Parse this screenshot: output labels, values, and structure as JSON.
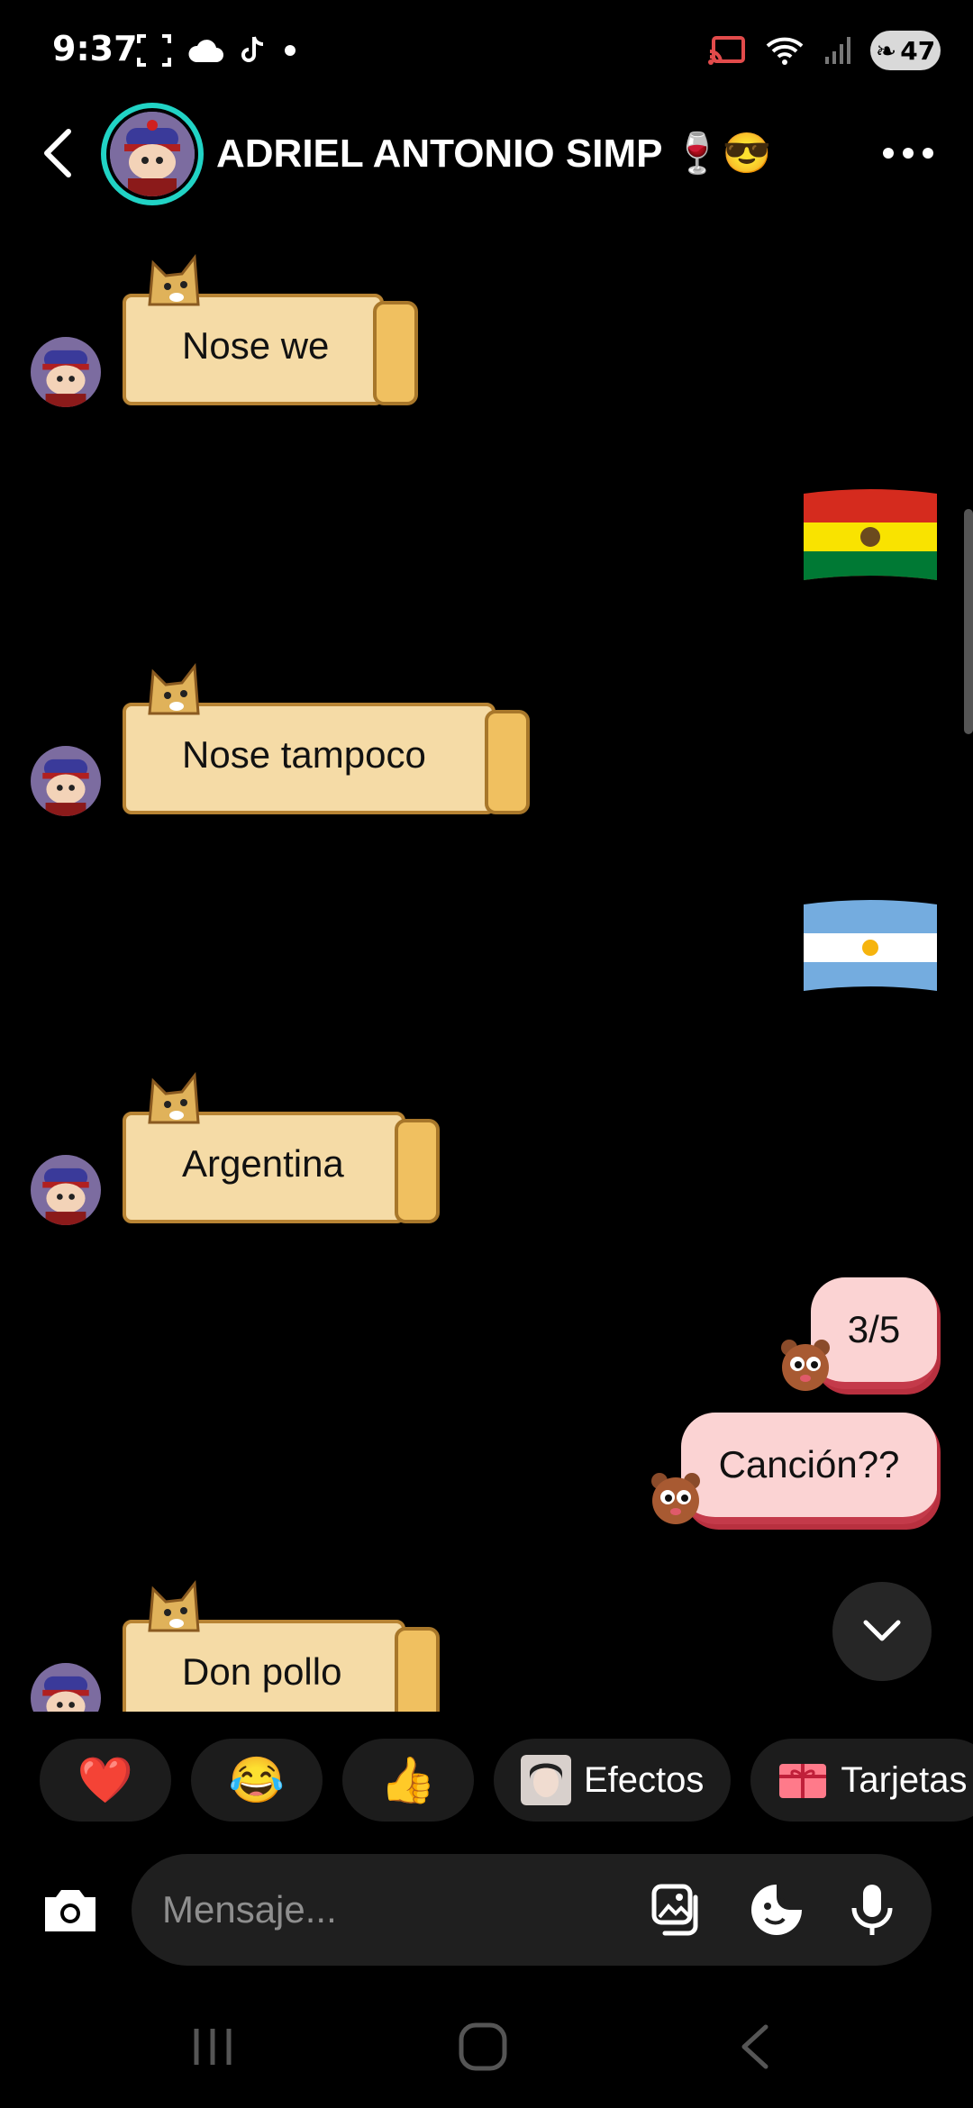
{
  "status_bar": {
    "time": "9:37",
    "battery": "47"
  },
  "header": {
    "title": "ADRIEL ANTONIO SIMP 🍷😎"
  },
  "messages": [
    {
      "side": "left",
      "type": "sticker-text",
      "text": "Nose we"
    },
    {
      "side": "right",
      "type": "flag",
      "label": "Bolivia flag"
    },
    {
      "side": "left",
      "type": "sticker-text",
      "text": "Nose tampoco"
    },
    {
      "side": "right",
      "type": "flag",
      "label": "Argentina flag"
    },
    {
      "side": "left",
      "type": "sticker-text",
      "text": "Argentina"
    },
    {
      "side": "right",
      "type": "text",
      "text": "3/5"
    },
    {
      "side": "right",
      "type": "text",
      "text": "Canción??"
    },
    {
      "side": "left",
      "type": "sticker-text",
      "text": "Don pollo"
    }
  ],
  "quick_reactions": [
    {
      "emoji": "❤️"
    },
    {
      "emoji": "😂"
    },
    {
      "emoji": "👍"
    },
    {
      "label": "Efectos"
    },
    {
      "label": "Tarjetas"
    }
  ],
  "composer": {
    "placeholder": "Mensaje..."
  },
  "colors": {
    "accent_ring": "#21d3c5",
    "sticker_bg": "#f5dba6",
    "pink_bubble": "#fbd3d3"
  }
}
